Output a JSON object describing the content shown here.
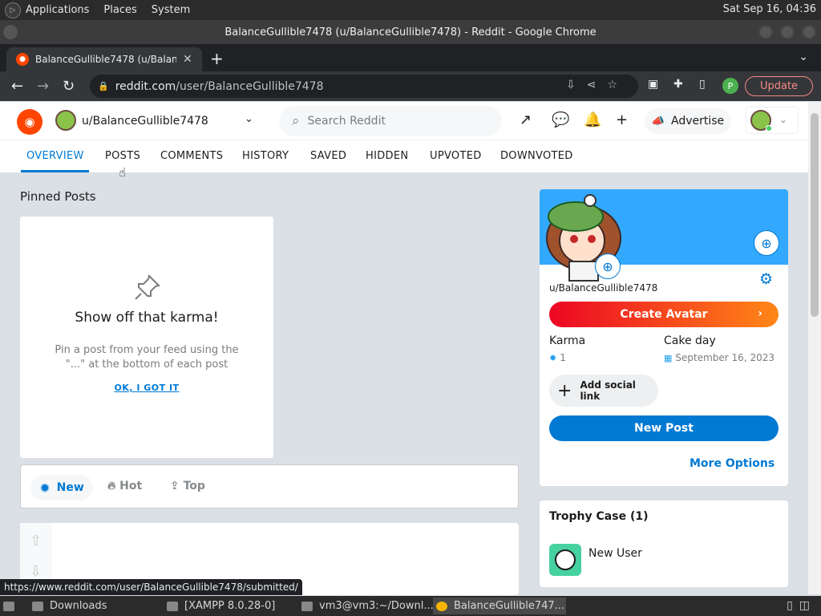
{
  "os": {
    "menu": [
      "Applications",
      "Places",
      "System"
    ],
    "clock": "Sat Sep 16, 04:36"
  },
  "window": {
    "title": "BalanceGullible7478 (u/BalanceGullible7478) - Reddit - Google Chrome"
  },
  "browser": {
    "tab_label": "BalanceGullible7478 (u/BalanceGullible7478) - Reddit",
    "tab_close": "✕",
    "new_tab": "+",
    "url_host": "reddit.com",
    "url_path": "/user/BalanceGullible7478",
    "profile_initial": "P",
    "update_label": "Update"
  },
  "reddit": {
    "community_name": "u/BalanceGullible7478",
    "search_placeholder": "Search Reddit",
    "advertise_label": "Advertise",
    "profile_tabs": [
      "OVERVIEW",
      "POSTS",
      "COMMENTS",
      "HISTORY",
      "SAVED",
      "HIDDEN",
      "UPVOTED",
      "DOWNVOTED"
    ],
    "active_tab": "OVERVIEW"
  },
  "pinned": {
    "title": "Pinned Posts",
    "heading": "Show off that karma!",
    "body": "Pin a post from your feed using the \"...\" at the bottom of each post",
    "ok_label": "OK, I GOT IT"
  },
  "sort": {
    "new": "New",
    "hot": "Hot",
    "top": "Top"
  },
  "profile": {
    "username": "u/BalanceGullible7478",
    "create_avatar": "Create Avatar",
    "karma_label": "Karma",
    "karma_value": "1",
    "cake_label": "Cake day",
    "cake_value": "September 16, 2023",
    "social_link": "Add social link",
    "new_post": "New Post",
    "more_options": "More Options"
  },
  "trophy": {
    "title": "Trophy Case (1)",
    "item": "New User"
  },
  "status_url": "https://www.reddit.com/user/BalanceGullible7478/submitted/",
  "taskbar": {
    "items": [
      "Downloads",
      "[XAMPP 8.0.28-0]",
      "vm3@vm3:~/Downl...",
      "BalanceGullible747..."
    ]
  },
  "colors": {
    "reddit_orange": "#ff4500",
    "reddit_blue": "#0079d3",
    "banner_blue": "#33a8ff"
  },
  "icons": [
    "reddit-logo-icon",
    "search-icon",
    "popular-icon",
    "chat-icon",
    "bell-icon",
    "plus-icon",
    "megaphone-icon",
    "pin-icon",
    "new-sort-icon",
    "hot-sort-icon",
    "top-sort-icon",
    "gear-icon",
    "add-image-icon",
    "upvote-icon",
    "downvote-icon"
  ]
}
